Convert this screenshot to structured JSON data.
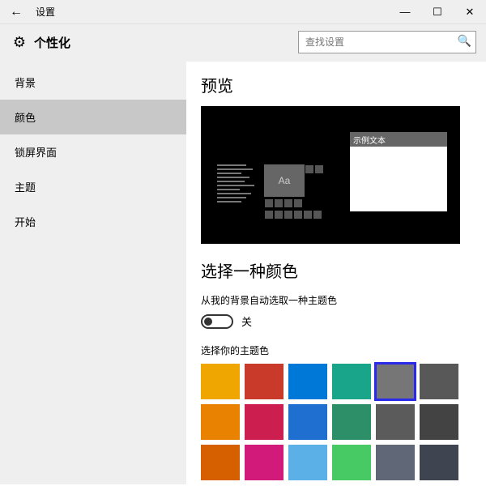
{
  "titlebar": {
    "back": "←",
    "title": "设置",
    "min": "—",
    "max": "☐",
    "close": "✕"
  },
  "header": {
    "gear": "⚙",
    "title": "个性化"
  },
  "search": {
    "placeholder": "查找设置",
    "icon": "🔍"
  },
  "sidebar": {
    "items": [
      {
        "label": "背景",
        "selected": false
      },
      {
        "label": "颜色",
        "selected": true
      },
      {
        "label": "锁屏界面",
        "selected": false
      },
      {
        "label": "主题",
        "selected": false
      },
      {
        "label": "开始",
        "selected": false
      }
    ]
  },
  "content": {
    "preview_heading": "预览",
    "preview_tile_text": "Aa",
    "preview_window_title": "示例文本",
    "choose_color_heading": "选择一种颜色",
    "auto_pick_label": "从我的背景自动选取一种主题色",
    "toggle_state": "关",
    "accent_label": "选择你的主题色",
    "swatches": [
      {
        "c": "#f0a600",
        "sel": false
      },
      {
        "c": "#c93a2b",
        "sel": false
      },
      {
        "c": "#0078d7",
        "sel": false
      },
      {
        "c": "#18a589",
        "sel": false
      },
      {
        "c": "#767676",
        "sel": true
      },
      {
        "c": "#585858",
        "sel": false
      },
      {
        "c": "#e88200",
        "sel": false
      },
      {
        "c": "#cc1f4f",
        "sel": false
      },
      {
        "c": "#1f6fd0",
        "sel": false
      },
      {
        "c": "#2d8f68",
        "sel": false
      },
      {
        "c": "#5b5b5b",
        "sel": false
      },
      {
        "c": "#434343",
        "sel": false
      },
      {
        "c": "#d66000",
        "sel": false
      },
      {
        "c": "#d11a7a",
        "sel": false
      },
      {
        "c": "#5bb0e8",
        "sel": false
      },
      {
        "c": "#47c964",
        "sel": false
      },
      {
        "c": "#606878",
        "sel": false
      },
      {
        "c": "#3e4551",
        "sel": false
      }
    ]
  }
}
